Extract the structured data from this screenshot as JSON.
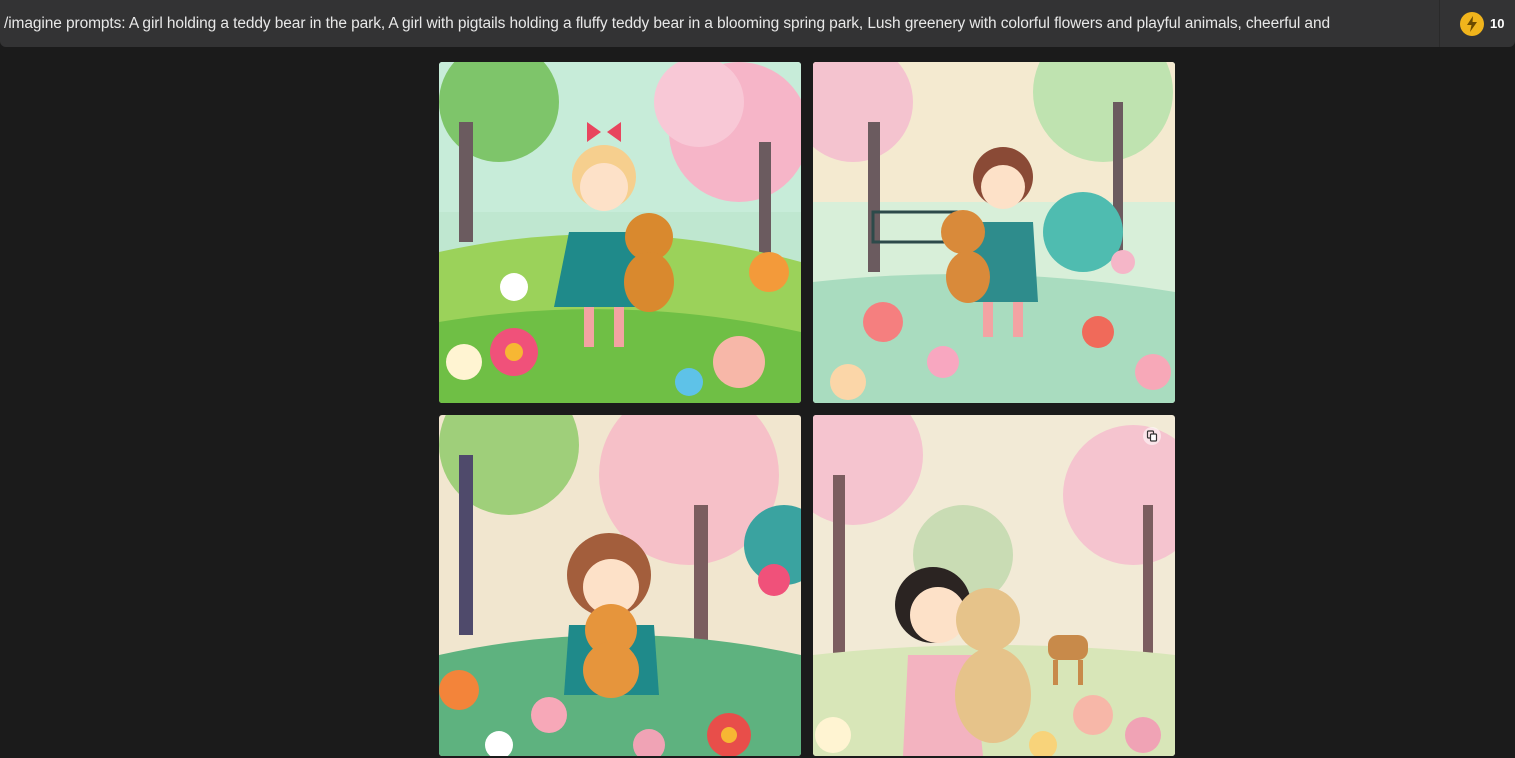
{
  "prompt": {
    "text": "/imagine prompts: A girl holding a teddy bear in the park, A girl with pigtails holding a fluffy teddy bear in a blooming spring park, Lush greenery with colorful flowers and playful animals, cheerful and"
  },
  "credits": {
    "icon": "lightning-bolt-icon",
    "count": "10",
    "accent": "#f0b41c"
  },
  "images": [
    {
      "name": "generated-image-1",
      "alt": "girl with teddy bear in spring park 1"
    },
    {
      "name": "generated-image-2",
      "alt": "girl with teddy bear in spring park 2"
    },
    {
      "name": "generated-image-3",
      "alt": "girl with teddy bear in spring park 3"
    },
    {
      "name": "generated-image-4",
      "alt": "girl with teddy bear in spring park 4",
      "overlay_icon": "copy-icon"
    }
  ]
}
